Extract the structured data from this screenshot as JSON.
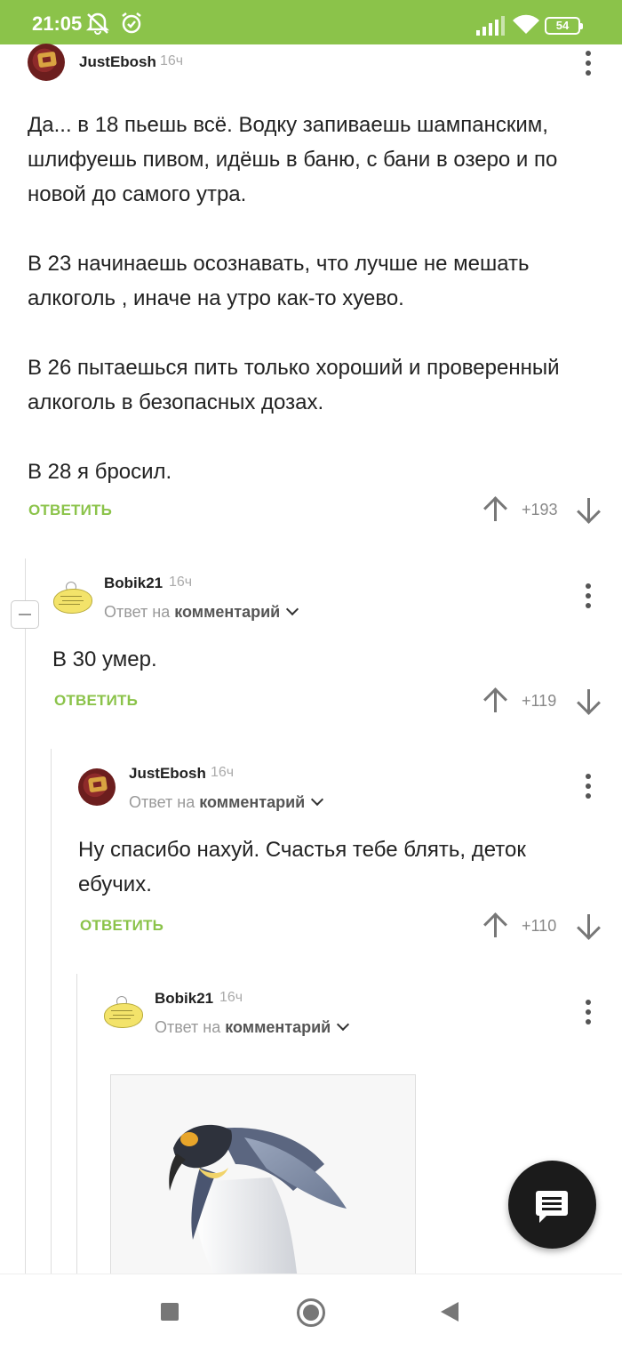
{
  "status_bar": {
    "time": "21:05",
    "battery": "54",
    "icons": [
      "muted-bell-icon",
      "alarm-icon",
      "signal-icon",
      "wifi-icon",
      "battery-icon"
    ]
  },
  "comments": [
    {
      "username": "JustEbosh",
      "time": "16ч",
      "paragraphs": [
        "Да... в 18 пьешь всё. Водку запиваешь шампанским, шлифуешь пивом, идёшь в баню, с бани в озеро и по новой до самого утра.",
        "В 23 начинаешь осознавать, что лучше не мешать алкоголь , иначе на утро как-то хуево.",
        "В 26 пытаешься пить только хороший и проверенный алкоголь в безопасных дозах.",
        "В 28 я бросил."
      ],
      "reply_label": "ОТВЕТИТЬ",
      "score": "+193"
    },
    {
      "username": "Bobik21",
      "time": "16ч",
      "reply_to_prefix": "Ответ на",
      "reply_to_target": "комментарий",
      "text": "В 30 умер.",
      "reply_label": "ОТВЕТИТЬ",
      "score": "+119"
    },
    {
      "username": "JustEbosh",
      "time": "16ч",
      "reply_to_prefix": "Ответ на",
      "reply_to_target": "комментарий",
      "text": "Ну спасибо нахуй. Счастья тебе блять, деток ебучих.",
      "reply_label": "ОТВЕТИТЬ",
      "score": "+110"
    },
    {
      "username": "Bobik21",
      "time": "16ч",
      "reply_to_prefix": "Ответ на",
      "reply_to_target": "комментарий",
      "image": "penguin-image"
    }
  ],
  "accent_color": "#8bc34a",
  "nav": [
    "recents-icon",
    "home-icon",
    "back-icon"
  ]
}
